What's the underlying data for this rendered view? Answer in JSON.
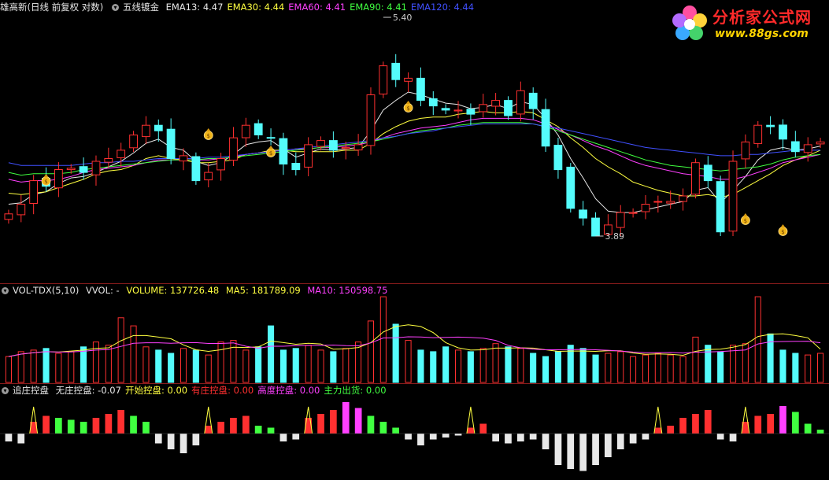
{
  "header_main": {
    "title": "雄高新(日线 前复权 对数)",
    "indicator": "五线镀金",
    "ema_labels": [
      {
        "text": "EMA13: 4.47",
        "color": "#e8e8e8"
      },
      {
        "text": "EMA30: 4.44",
        "color": "#ffff40"
      },
      {
        "text": "EMA60: 4.41",
        "color": "#ff40ff"
      },
      {
        "text": "EMA90: 4.41",
        "color": "#40ff40"
      },
      {
        "text": "EMA120: 4.44",
        "color": "#4050ff"
      }
    ]
  },
  "header_vol": {
    "name": "VOL-TDX(5,10)",
    "vvol": "VVOL: -",
    "volume": "VOLUME: 137726.48",
    "ma5": "MA5: 181789.09",
    "ma10": "MA10: 150598.75"
  },
  "header_ctrl": {
    "name": "追庄控盘",
    "items": [
      {
        "text": "无庄控盘: -0.07",
        "color": "#e8e8e8"
      },
      {
        "text": "开始控盘: 0.00",
        "color": "#ffff40"
      },
      {
        "text": "有庄控盘: 0.00",
        "color": "#ff3030"
      },
      {
        "text": "高度控盘: 0.00",
        "color": "#ff40ff"
      },
      {
        "text": "主力出货: 0.00",
        "color": "#40ff40"
      }
    ]
  },
  "logo": {
    "title": "分析家公式网",
    "url": "www.88gs.com"
  },
  "colors": {
    "up": "#ff3030",
    "down": "#54fcfc",
    "bg": "#000000",
    "frame": "#8a1c1c"
  },
  "chart_data": [
    {
      "type": "candlestick",
      "name": "price",
      "annotations": [
        {
          "text": "5.40",
          "kind": "high"
        },
        {
          "text": "3.89",
          "kind": "low"
        }
      ],
      "series": [
        {
          "name": "EMA13",
          "color": "#e8e8e8",
          "values": [
            4.05,
            4.06,
            4.12,
            4.14,
            4.2,
            4.24,
            4.25,
            4.28,
            4.32,
            4.36,
            4.42,
            4.49,
            4.52,
            4.46,
            4.44,
            4.36,
            4.33,
            4.35,
            4.41,
            4.48,
            4.5,
            4.51,
            4.45,
            4.39,
            4.42,
            4.45,
            4.44,
            4.45,
            4.46,
            4.58,
            4.73,
            4.8,
            4.86,
            4.84,
            4.81,
            4.78,
            4.77,
            4.74,
            4.75,
            4.77,
            4.74,
            4.79,
            4.77,
            4.67,
            4.55,
            4.38,
            4.24,
            4.09,
            4.0,
            3.99,
            3.99,
            4.01,
            4.03,
            4.05,
            4.07,
            4.15,
            4.17,
            4.06,
            4.15,
            4.25,
            4.37,
            4.44,
            4.46,
            4.44,
            4.45,
            4.47
          ]
        },
        {
          "name": "EMA30",
          "color": "#ffff40",
          "values": [
            4.13,
            4.12,
            4.13,
            4.14,
            4.17,
            4.2,
            4.23,
            4.27,
            4.29,
            4.3,
            4.33,
            4.38,
            4.4,
            4.38,
            4.37,
            4.35,
            4.35,
            4.36,
            4.37,
            4.41,
            4.42,
            4.44,
            4.44,
            4.43,
            4.43,
            4.43,
            4.43,
            4.44,
            4.44,
            4.49,
            4.56,
            4.61,
            4.65,
            4.67,
            4.68,
            4.68,
            4.7,
            4.71,
            4.72,
            4.71,
            4.71,
            4.72,
            4.71,
            4.66,
            4.61,
            4.53,
            4.46,
            4.38,
            4.32,
            4.27,
            4.21,
            4.18,
            4.15,
            4.13,
            4.11,
            4.11,
            4.12,
            4.1,
            4.12,
            4.17,
            4.22,
            4.27,
            4.33,
            4.37,
            4.4,
            4.44
          ]
        },
        {
          "name": "EMA60",
          "color": "#ff40ff",
          "values": [
            4.23,
            4.21,
            4.22,
            4.22,
            4.23,
            4.25,
            4.28,
            4.3,
            4.31,
            4.32,
            4.33,
            4.35,
            4.37,
            4.37,
            4.37,
            4.37,
            4.37,
            4.38,
            4.39,
            4.41,
            4.42,
            4.43,
            4.44,
            4.45,
            4.45,
            4.46,
            4.46,
            4.47,
            4.48,
            4.5,
            4.53,
            4.56,
            4.58,
            4.6,
            4.61,
            4.62,
            4.64,
            4.66,
            4.67,
            4.67,
            4.67,
            4.67,
            4.66,
            4.63,
            4.59,
            4.55,
            4.51,
            4.47,
            4.44,
            4.4,
            4.36,
            4.33,
            4.31,
            4.29,
            4.27,
            4.26,
            4.25,
            4.23,
            4.23,
            4.25,
            4.28,
            4.31,
            4.35,
            4.37,
            4.39,
            4.41
          ]
        },
        {
          "name": "EMA90",
          "color": "#40ff40",
          "values": [
            4.28,
            4.26,
            4.27,
            4.27,
            4.27,
            4.28,
            4.3,
            4.31,
            4.32,
            4.33,
            4.34,
            4.35,
            4.36,
            4.37,
            4.37,
            4.37,
            4.38,
            4.38,
            4.39,
            4.4,
            4.41,
            4.42,
            4.43,
            4.44,
            4.45,
            4.46,
            4.47,
            4.48,
            4.49,
            4.5,
            4.52,
            4.54,
            4.56,
            4.58,
            4.59,
            4.6,
            4.62,
            4.63,
            4.64,
            4.64,
            4.64,
            4.64,
            4.63,
            4.61,
            4.58,
            4.55,
            4.52,
            4.49,
            4.46,
            4.43,
            4.4,
            4.37,
            4.35,
            4.33,
            4.32,
            4.31,
            4.3,
            4.29,
            4.3,
            4.31,
            4.32,
            4.34,
            4.37,
            4.39,
            4.4,
            4.41
          ]
        },
        {
          "name": "EMA120",
          "color": "#4050ff",
          "values": [
            4.35,
            4.33,
            4.33,
            4.33,
            4.33,
            4.33,
            4.34,
            4.35,
            4.35,
            4.36,
            4.36,
            4.37,
            4.38,
            4.38,
            4.38,
            4.38,
            4.39,
            4.39,
            4.4,
            4.41,
            4.42,
            4.43,
            4.44,
            4.45,
            4.46,
            4.47,
            4.48,
            4.49,
            4.5,
            4.51,
            4.53,
            4.54,
            4.56,
            4.57,
            4.58,
            4.6,
            4.61,
            4.62,
            4.63,
            4.63,
            4.63,
            4.63,
            4.63,
            4.61,
            4.6,
            4.58,
            4.56,
            4.54,
            4.52,
            4.5,
            4.48,
            4.46,
            4.45,
            4.44,
            4.43,
            4.42,
            4.41,
            4.4,
            4.4,
            4.41,
            4.41,
            4.42,
            4.43,
            4.44,
            4.44,
            4.44
          ]
        }
      ],
      "close": [
        3.98,
        4.05,
        4.22,
        4.18,
        4.3,
        4.31,
        4.28,
        4.36,
        4.38,
        4.44,
        4.55,
        4.62,
        4.58,
        4.38,
        4.4,
        4.22,
        4.28,
        4.38,
        4.53,
        4.62,
        4.55,
        4.53,
        4.34,
        4.3,
        4.48,
        4.51,
        4.44,
        4.46,
        4.48,
        4.84,
        5.05,
        4.95,
        4.96,
        4.8,
        4.76,
        4.73,
        4.73,
        4.7,
        4.77,
        4.8,
        4.69,
        4.87,
        4.74,
        4.47,
        4.3,
        4.02,
        3.95,
        3.82,
        3.9,
        3.99,
        3.99,
        4.05,
        4.07,
        4.07,
        4.11,
        4.35,
        4.22,
        3.85,
        4.36,
        4.5,
        4.62,
        4.61,
        4.52,
        4.43,
        4.48,
        4.5
      ]
    },
    {
      "type": "bar",
      "name": "volume",
      "values": [
        1.6,
        1.9,
        2.0,
        2.1,
        1.8,
        1.9,
        2.2,
        2.5,
        2.3,
        4.0,
        3.5,
        2.2,
        2.0,
        1.8,
        2.1,
        2.0,
        1.7,
        2.5,
        2.6,
        2.0,
        2.2,
        3.5,
        2.0,
        2.1,
        2.3,
        2.0,
        1.9,
        2.1,
        2.5,
        3.8,
        5.3,
        3.6,
        2.6,
        2.0,
        1.9,
        2.2,
        2.0,
        1.9,
        2.1,
        2.4,
        2.2,
        2.1,
        1.8,
        1.6,
        1.9,
        2.3,
        2.1,
        1.7,
        1.8,
        1.9,
        1.6,
        1.7,
        1.8,
        1.7,
        1.6,
        2.8,
        2.3,
        1.9,
        2.3,
        2.4,
        5.3,
        3.0,
        2.0,
        1.8,
        1.7,
        1.8
      ]
    },
    {
      "type": "bar",
      "name": "control",
      "values": [
        -0.4,
        -0.5,
        0.6,
        0.9,
        0.8,
        0.7,
        0.6,
        0.8,
        1.0,
        1.2,
        0.9,
        0.6,
        -0.5,
        -0.8,
        -1.0,
        -0.6,
        0.4,
        0.6,
        0.8,
        0.9,
        0.4,
        0.3,
        -0.4,
        -0.3,
        0.8,
        1.0,
        1.2,
        1.6,
        1.3,
        0.9,
        0.6,
        0.3,
        -0.3,
        -0.6,
        -0.3,
        -0.2,
        -0.1,
        0.3,
        0.5,
        -0.4,
        -0.5,
        -0.4,
        -0.3,
        -0.8,
        -1.6,
        -1.8,
        -1.9,
        -1.6,
        -1.2,
        -0.8,
        -0.5,
        -0.3,
        0.3,
        0.4,
        0.8,
        1.0,
        1.2,
        -0.3,
        -0.4,
        0.6,
        0.9,
        1.0,
        1.4,
        1.1,
        0.5,
        0.2
      ]
    }
  ]
}
